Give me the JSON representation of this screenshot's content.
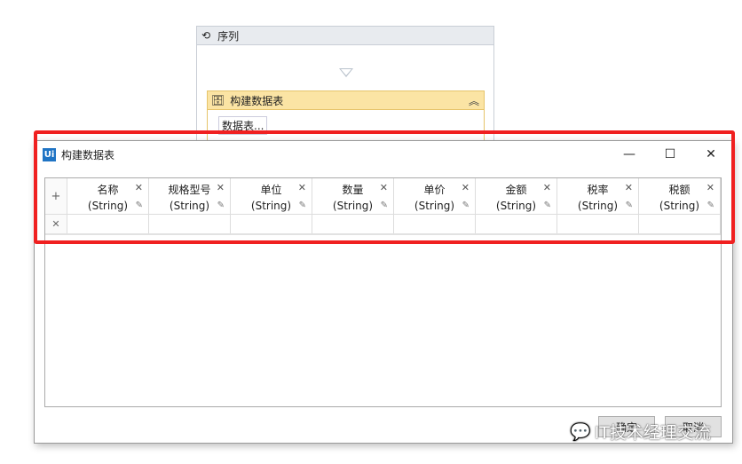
{
  "designer": {
    "sequence_title": "序列",
    "activity_title": "构建数据表",
    "activity_input": "数据表..."
  },
  "dialog": {
    "title": "构建数据表",
    "logo": "Ui",
    "columns": [
      {
        "name": "名称",
        "type": "(String)"
      },
      {
        "name": "规格型号",
        "type": "(String)"
      },
      {
        "name": "单位",
        "type": "(String)"
      },
      {
        "name": "数量",
        "type": "(String)"
      },
      {
        "name": "单价",
        "type": "(String)"
      },
      {
        "name": "金额",
        "type": "(String)"
      },
      {
        "name": "税率",
        "type": "(String)"
      },
      {
        "name": "税额",
        "type": "(String)"
      }
    ],
    "ok_label": "确定",
    "cancel_label": "取消"
  },
  "watermark": "IT技术经理交流",
  "colors": {
    "highlight": "#f02020",
    "ui_logo": "#1f74c4",
    "activity_header": "#fbe4a4"
  }
}
